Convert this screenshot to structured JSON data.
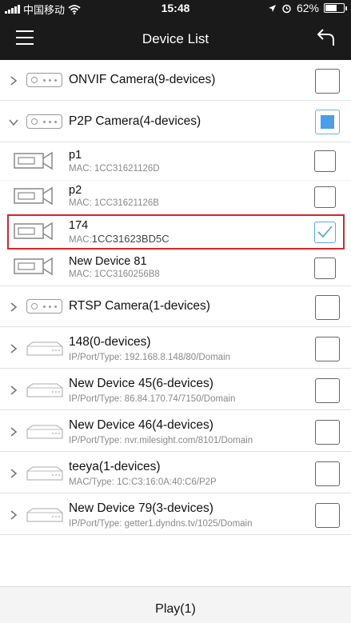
{
  "status_bar": {
    "carrier": "中国移动",
    "time": "15:48",
    "battery": "62%"
  },
  "header": {
    "title": "Device List"
  },
  "groups": [
    {
      "title": "ONVIF Camera(9-devices)"
    },
    {
      "title": "P2P Camera(4-devices)"
    },
    {
      "title": "RTSP Camera(1-devices)"
    }
  ],
  "p2p_devices": [
    {
      "name": "p1",
      "mac_label": "MAC: ",
      "mac": "1CC31621126D"
    },
    {
      "name": "p2",
      "mac_label": "MAC: ",
      "mac": "1CC31621126B"
    },
    {
      "name": "174",
      "mac_label": "MAC:",
      "mac": "1CC31623BD5C"
    },
    {
      "name": "New Device 81",
      "mac_label": "MAC: ",
      "mac": "1CC3160256B8"
    }
  ],
  "nvr_devices": [
    {
      "title": "148(0-devices)",
      "sub": "IP/Port/Type: 192.168.8.148/80/Domain"
    },
    {
      "title": "New Device 45(6-devices)",
      "sub": "IP/Port/Type: 86.84.170.74/7150/Domain"
    },
    {
      "title": "New Device 46(4-devices)",
      "sub": "IP/Port/Type: nvr.milesight.com/8101/Domain"
    },
    {
      "title": "teeya(1-devices)",
      "sub": "MAC/Type: 1C:C3:16:0A:40:C6/P2P"
    },
    {
      "title": "New Device 79(3-devices)",
      "sub": "IP/Port/Type: getter1.dyndns.tv/1025/Domain"
    }
  ],
  "footer": {
    "play_label": "Play(1)"
  },
  "colors": {
    "accent": "#4a9ee6",
    "highlight": "#d8262c",
    "topbar": "#1a1a1a"
  }
}
